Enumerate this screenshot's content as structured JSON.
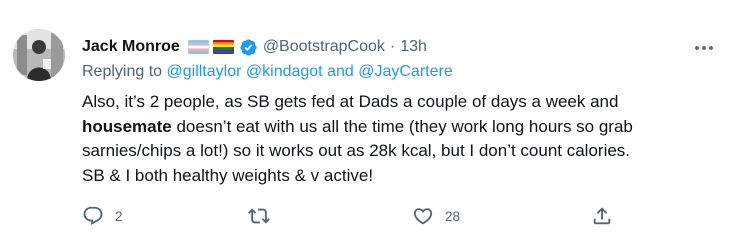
{
  "tweet": {
    "author": {
      "name": "Jack Monroe",
      "handle": "@BootstrapCook",
      "flags": [
        "transgender-flag",
        "rainbow-flag"
      ],
      "verified": true
    },
    "separator": "·",
    "time": "13h",
    "reply": {
      "prefix": "Replying to",
      "mentions": [
        "@gilltaylor",
        "@kindagot",
        "@JayCartere"
      ],
      "join_word": "and"
    },
    "body": {
      "line1": "Also, it’s 2 people, as SB gets fed at Dads a couple of days a week and",
      "line2_bold": "housemate",
      "line2_rest": " doesn’t eat with us all the time (they work long hours so grab",
      "line3": "sarnies/chips a lot!) so it works out as 28k kcal, but I don’t count calories.",
      "line4": "SB & I both healthy weights & v active!"
    },
    "actions": {
      "replies": "2",
      "retweets": "",
      "likes": "28"
    }
  },
  "colors": {
    "text": "#0f1419",
    "secondary": "#536471",
    "link": "#1d9bf0",
    "verified": "#1d9bf0"
  },
  "icons": [
    "more-icon",
    "reply-icon",
    "retweet-icon",
    "like-icon",
    "share-icon",
    "verified-icon"
  ]
}
